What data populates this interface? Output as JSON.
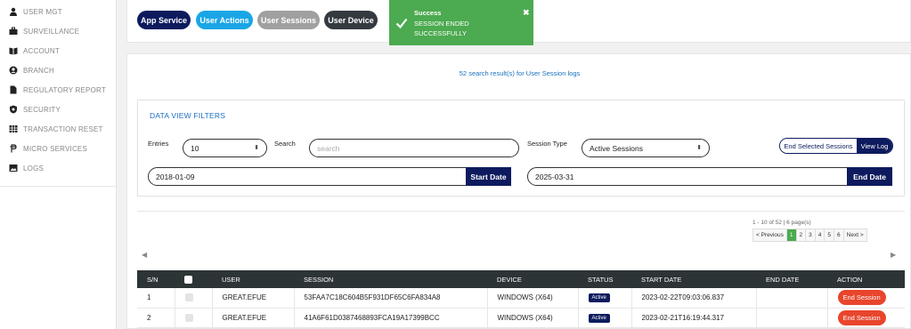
{
  "sidebar": {
    "items": [
      {
        "label": "USER MGT",
        "icon": "user-icon"
      },
      {
        "label": "SURVEILLANCE",
        "icon": "briefcase-icon"
      },
      {
        "label": "ACCOUNT",
        "icon": "book-icon"
      },
      {
        "label": "BRANCH",
        "icon": "person-circle-icon"
      },
      {
        "label": "REGULATORY REPORT",
        "icon": "file-icon"
      },
      {
        "label": "SECURITY",
        "icon": "shield-icon"
      },
      {
        "label": "TRANSACTION RESET",
        "icon": "table-icon"
      },
      {
        "label": "MICRO SERVICES",
        "icon": "currency-icon"
      },
      {
        "label": "LOGS",
        "icon": "image-icon"
      }
    ]
  },
  "top_tabs": {
    "app_service": "App Service",
    "user_actions": "User Actions",
    "user_sessions": "User Sessions",
    "user_device": "User Device"
  },
  "toast": {
    "title": "Success",
    "message": "SESSION ENDED SUCCESSFULLY",
    "close": "✖",
    "color": "#4caa50"
  },
  "main": {
    "result_text": "52 search result(s) for User Session logs"
  },
  "filters": {
    "title": "DATA VIEW FILTERS",
    "entries_label": "Entries",
    "entries_value": "10",
    "search_label": "Search",
    "search_placeholder": "search",
    "session_type_label": "Session Type",
    "session_type_value": "Active Sessions",
    "end_selected_label": "End Selected Sessions",
    "view_log_label": "View Log",
    "start_date_value": "2018-01-09",
    "start_date_button": "Start Date",
    "end_date_value": "2025-03-31",
    "end_date_button": "End Date"
  },
  "pagination": {
    "info": "1 - 10 of 52 | 6 page(s)",
    "previous": "< Previous",
    "pages": [
      "1",
      "2",
      "3",
      "4",
      "5",
      "6"
    ],
    "active_page": "1",
    "next": "Next >"
  },
  "table": {
    "headers": [
      "S/N",
      "",
      "USER",
      "SESSION",
      "DEVICE",
      "STATUS",
      "START DATE",
      "END DATE",
      "ACTION"
    ],
    "rows": [
      {
        "sn": "1",
        "user": "GREAT.EFUE",
        "session": "53FAA7C18C604B5F931DF65C6FA834A8",
        "device": "WINDOWS (X64)",
        "status": "Active",
        "start_date": "2023-02-22T09:03:06.837",
        "end_date": "",
        "action": "End Session"
      },
      {
        "sn": "2",
        "user": "GREAT.EFUE",
        "session": "41A6F61D0387468893FCA19A17399BCC",
        "device": "WINDOWS (X64)",
        "status": "Active",
        "start_date": "2023-02-21T16:19:44.317",
        "end_date": "",
        "action": "End Session"
      }
    ]
  },
  "colors": {
    "navy": "#0d1b5e",
    "light_blue": "#1aa6e6",
    "grey": "#a0a0a0",
    "dark": "#343a40",
    "link_blue": "#1b6fbf",
    "danger": "#e8452c"
  }
}
